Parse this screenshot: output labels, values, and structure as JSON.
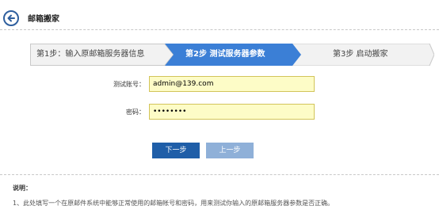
{
  "header": {
    "back_icon": "back-arrow-icon",
    "title": "邮箱搬家"
  },
  "steps": {
    "items": [
      {
        "label": "第1步：输入原邮箱服务器信息",
        "state": "done"
      },
      {
        "label": "第2步  测试服务器参数",
        "state": "active"
      },
      {
        "label": "第3步  启动搬家",
        "state": "pending"
      }
    ],
    "colors": {
      "active": "#3b7fd6",
      "inactive": "#f2f2f2",
      "border": "#c9c9c9"
    }
  },
  "form": {
    "account_label": "测试账号：",
    "account_value": "admin@139.com",
    "password_label": "密码：",
    "password_value": "12345678"
  },
  "buttons": {
    "next": "下一步",
    "prev": "上一步"
  },
  "notes": {
    "title": "说明：",
    "items": [
      "1、此处填写一个在原邮件系统中能够正常使用的邮箱帐号和密码，用来测试你输入的原邮箱服务器参数是否正确。"
    ]
  }
}
